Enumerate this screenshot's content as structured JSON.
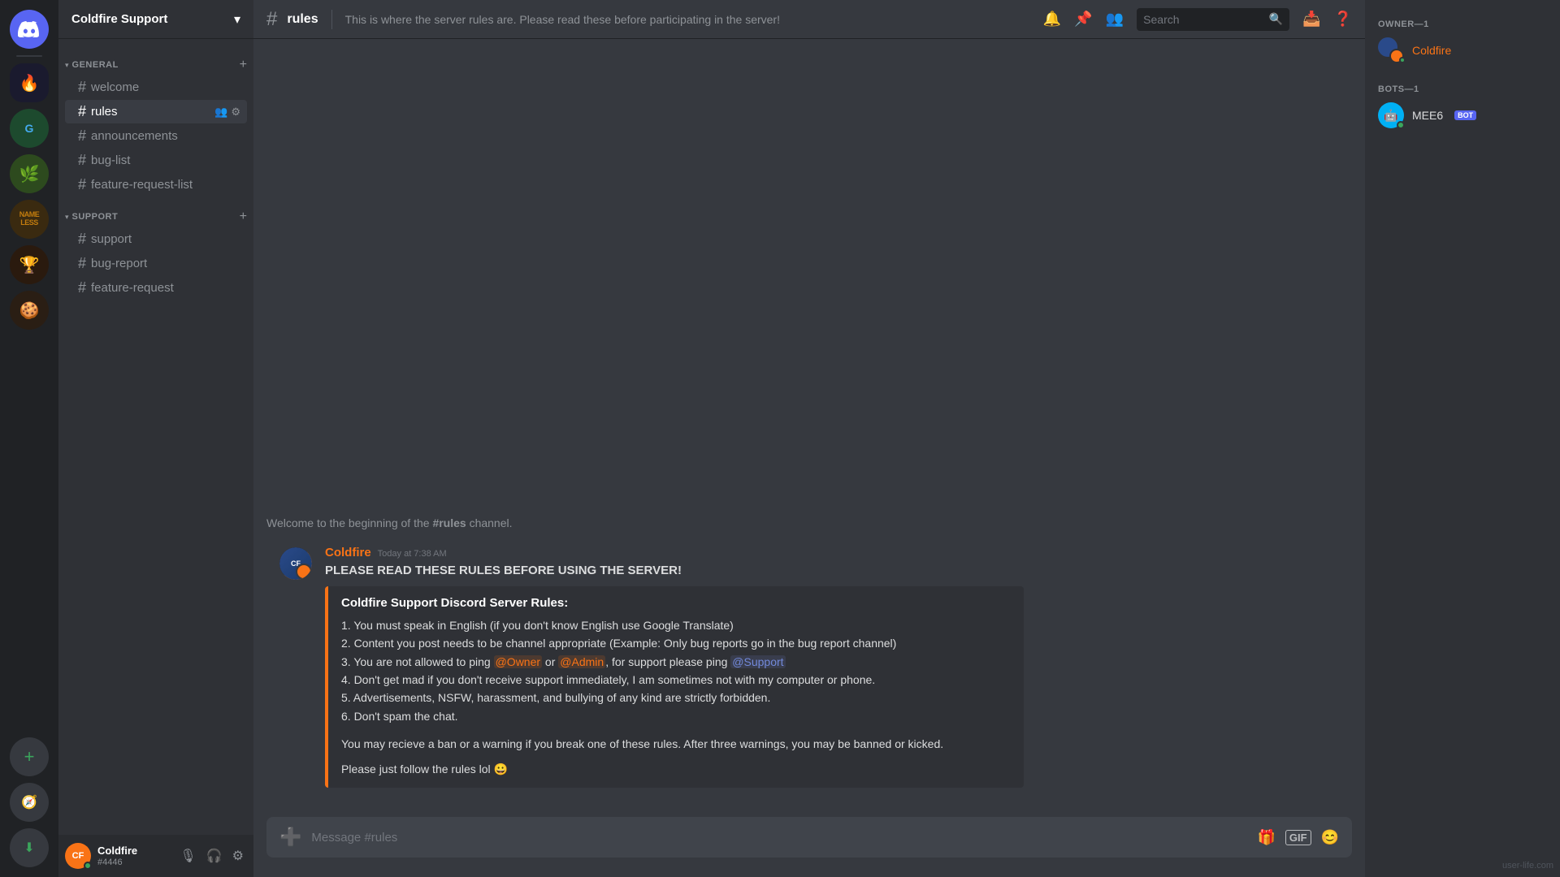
{
  "server_list": {
    "servers": [
      {
        "id": "discord-home",
        "label": "DC",
        "color": "#5865F2",
        "active": false
      },
      {
        "id": "server-1",
        "label": "🔥",
        "color": "#5865F2",
        "active": true
      },
      {
        "id": "server-2",
        "label": "G",
        "color": "#2d7d46",
        "active": false
      },
      {
        "id": "server-3",
        "label": "🌿",
        "color": "#2d7d46",
        "active": false
      },
      {
        "id": "server-4",
        "label": "NL",
        "color": "#c27c0e",
        "active": false
      },
      {
        "id": "server-5",
        "label": "🏆",
        "color": "#e67e22",
        "active": false
      },
      {
        "id": "server-6",
        "label": "🍪",
        "color": "#a67c52",
        "active": false
      }
    ],
    "add_label": "+",
    "discover_label": "🧭"
  },
  "channel_sidebar": {
    "server_name": "Coldfire Support",
    "categories": [
      {
        "id": "general",
        "name": "GENERAL",
        "channels": [
          {
            "id": "welcome",
            "name": "welcome",
            "active": false
          },
          {
            "id": "rules",
            "name": "rules",
            "active": true
          },
          {
            "id": "announcements",
            "name": "announcements",
            "active": false
          },
          {
            "id": "bug-list",
            "name": "bug-list",
            "active": false
          },
          {
            "id": "feature-request-list",
            "name": "feature-request-list",
            "active": false
          }
        ]
      },
      {
        "id": "support",
        "name": "SUPPORT",
        "channels": [
          {
            "id": "support",
            "name": "support",
            "active": false
          },
          {
            "id": "bug-report",
            "name": "bug-report",
            "active": false
          },
          {
            "id": "feature-request",
            "name": "feature-request",
            "active": false
          }
        ]
      }
    ],
    "user": {
      "name": "Coldfire",
      "discriminator": "#4446",
      "avatar_color": "#f97316"
    }
  },
  "channel_header": {
    "channel_name": "rules",
    "topic": "This is where the server rules are. Please read these before participating in the server!",
    "search_placeholder": "Search"
  },
  "chat": {
    "beginning_text_pre": "Welcome to the beginning of the ",
    "beginning_channel": "#rules",
    "beginning_text_post": " channel.",
    "message": {
      "author": "Coldfire",
      "timestamp": "Today at 7:38 AM",
      "header_text": "PLEASE READ THESE RULES BEFORE USING THE SERVER!",
      "embed": {
        "title": "Coldfire Support Discord Server Rules:",
        "rules": [
          "1. You must speak in English (if you don't know English use Google Translate)",
          "2. Content you post needs to be channel appropriate (Example: Only bug reports go in the bug report channel)",
          "3. You are not allowed to ping @Owner or @Admin, for support please ping @Support",
          "4. Don't get mad if you don't receive support immediately, I am sometimes not with my computer or phone.",
          "5. Advertisements, NSFW, harassment, and bullying of any kind are strictly forbidden.",
          "6. Don't spam the chat."
        ],
        "rule3_parts": {
          "pre": "3. You are not allowed to ping ",
          "owner": "@Owner",
          "mid1": " or ",
          "admin": "@Admin",
          "mid2": ", for support please ping ",
          "support": "@Support"
        },
        "footer1": "You may recieve a ban or a warning if you break one of these rules. After three warnings, you may be banned or kicked.",
        "footer2": "Please just follow the rules lol 😀"
      }
    },
    "input_placeholder": "Message #rules"
  },
  "right_sidebar": {
    "sections": [
      {
        "label": "OWNER—1",
        "members": [
          {
            "name": "Coldfire",
            "color": "#f97316",
            "status": "online",
            "is_owner": true
          }
        ]
      },
      {
        "label": "BOTS—1",
        "members": [
          {
            "name": "MEE6",
            "is_bot": true,
            "status": "online"
          }
        ]
      }
    ]
  },
  "icons": {
    "hash": "#",
    "bell": "🔔",
    "pin": "📌",
    "members": "👥",
    "search": "🔍",
    "inbox": "📥",
    "help": "❓",
    "chevron_down": "▾",
    "plus": "+",
    "mic": "🎙",
    "headphones": "🎧",
    "settings": "⚙",
    "gift": "🎁",
    "gif": "GIF",
    "emoji": "😊",
    "add": "➕"
  },
  "watermark": "user-life.com"
}
